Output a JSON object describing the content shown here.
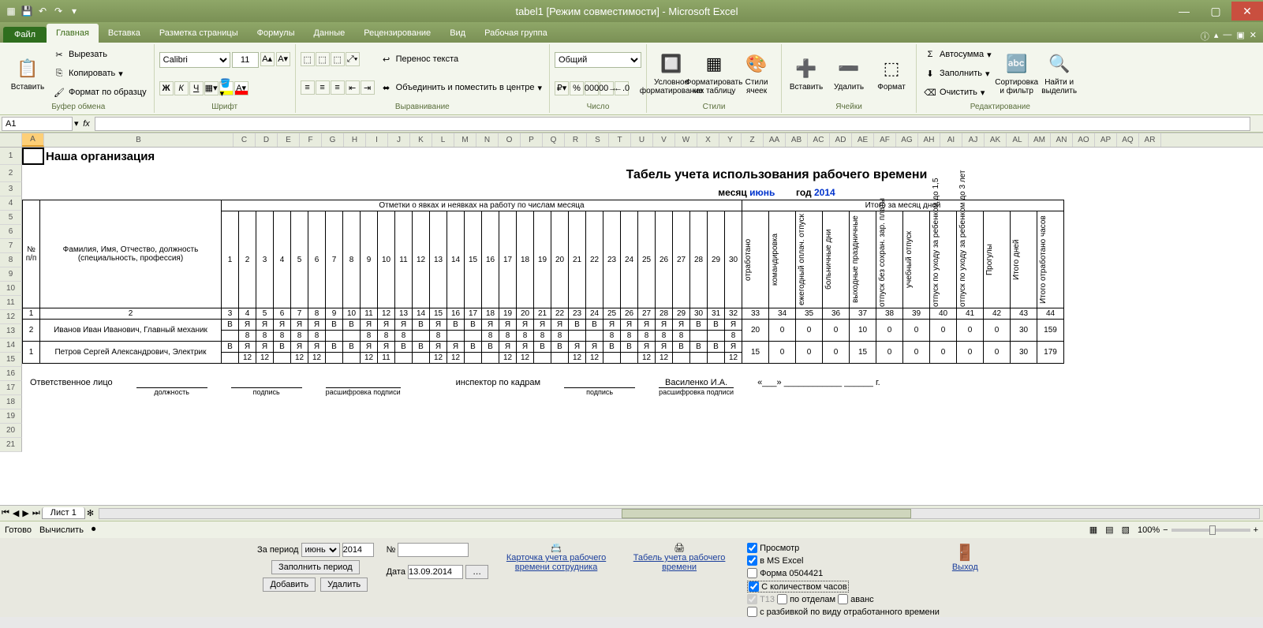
{
  "window": {
    "title": "tabel1  [Режим совместимости] - Microsoft Excel"
  },
  "qat": {
    "save": "💾",
    "undo": "↶",
    "redo": "↷"
  },
  "tabs": {
    "file": "Файл",
    "items": [
      "Главная",
      "Вставка",
      "Разметка страницы",
      "Формулы",
      "Данные",
      "Рецензирование",
      "Вид",
      "Рабочая группа"
    ],
    "active": 0
  },
  "clipboard": {
    "paste": "Вставить",
    "cut": "Вырезать",
    "copy": "Копировать",
    "painter": "Формат по образцу",
    "group": "Буфер обмена"
  },
  "font": {
    "name": "Calibri",
    "size": "11",
    "group": "Шрифт",
    "bold": "Ж",
    "italic": "К",
    "under": "Ч"
  },
  "align": {
    "wrap": "Перенос текста",
    "merge": "Объединить и поместить в центре",
    "group": "Выравнивание"
  },
  "number": {
    "format": "Общий",
    "group": "Число"
  },
  "styles": {
    "cond": "Условное форматирование",
    "table": "Форматировать как таблицу",
    "cellstyles": "Стили ячеек",
    "group": "Стили"
  },
  "cells": {
    "insert": "Вставить",
    "delete": "Удалить",
    "format": "Формат",
    "group": "Ячейки"
  },
  "editing": {
    "sum": "Автосумма",
    "fill": "Заполнить",
    "clear": "Очистить",
    "sort": "Сортировка и фильтр",
    "find": "Найти и выделить",
    "group": "Редактирование"
  },
  "namebox": "A1",
  "columns": [
    "A",
    "B",
    "C",
    "D",
    "E",
    "F",
    "G",
    "H",
    "I",
    "J",
    "K",
    "L",
    "M",
    "N",
    "O",
    "P",
    "Q",
    "R",
    "S",
    "T",
    "U",
    "V",
    "W",
    "X",
    "Y",
    "Z",
    "AA",
    "AB",
    "AC",
    "AD",
    "AE",
    "AF",
    "AG",
    "AH",
    "AI",
    "AJ",
    "AK",
    "AL",
    "AM",
    "AN",
    "AO",
    "AP",
    "AQ",
    "AR"
  ],
  "sheet": {
    "org": "Наша организация",
    "title": "Табель учета использования рабочего времени",
    "month_label": "месяц",
    "month": "июнь",
    "year_label": "год",
    "year": "2014",
    "hdr_marks": "Отметки о явках и неявках на работу по числам месяца",
    "hdr_totals": "Итого за месяц дней",
    "hdr_num": "№ п/п",
    "hdr_fio": "Фамилия, Имя, Отчество, должность (специальность, профессия)",
    "days": [
      "1",
      "2",
      "3",
      "4",
      "5",
      "6",
      "7",
      "8",
      "9",
      "10",
      "11",
      "12",
      "13",
      "14",
      "15",
      "16",
      "17",
      "18",
      "19",
      "20",
      "21",
      "22",
      "23",
      "24",
      "25",
      "26",
      "27",
      "28",
      "29",
      "30"
    ],
    "totcols": [
      "отработано",
      "командировка",
      "ежегодный оплач. отпуск",
      "больничные дни",
      "выходные праздничные",
      "отпуск без сохран. зар. платы",
      "учебный отпуск",
      "отпуск по уходу за ребенком до 1,5",
      "отпуск по уходу за ребенком до 3 лет",
      "Прогулы",
      "Итого дней",
      "Итого отработано часов"
    ],
    "numrow": [
      "1",
      "2",
      "3",
      "4",
      "5",
      "6",
      "7",
      "8",
      "9",
      "10",
      "11",
      "12",
      "13",
      "14",
      "15",
      "16",
      "17",
      "18",
      "19",
      "20",
      "21",
      "22",
      "23",
      "24",
      "25",
      "26",
      "27",
      "28",
      "29",
      "30",
      "31",
      "32",
      "33",
      "34",
      "35",
      "36",
      "37",
      "38",
      "39",
      "40",
      "41",
      "42",
      "43",
      "44"
    ],
    "rows": [
      {
        "n": "2",
        "fio": "Иванов Иван Иванович, Главный механик",
        "marks": [
          "В",
          "Я",
          "Я",
          "Я",
          "Я",
          "Я",
          "В",
          "В",
          "Я",
          "Я",
          "Я",
          "В",
          "Я",
          "В",
          "В",
          "Я",
          "Я",
          "Я",
          "Я",
          "Я",
          "В",
          "В",
          "Я",
          "Я",
          "Я",
          "Я",
          "Я",
          "В",
          "В",
          "Я"
        ],
        "hours": [
          "",
          "8",
          "8",
          "8",
          "8",
          "8",
          "",
          "",
          "8",
          "8",
          "8",
          "",
          "8",
          "",
          "",
          "8",
          "8",
          "8",
          "8",
          "8",
          "",
          "",
          "8",
          "8",
          "8",
          "8",
          "8",
          "",
          "",
          "8"
        ],
        "tot": [
          "20",
          "0",
          "0",
          "0",
          "10",
          "0",
          "0",
          "0",
          "0",
          "0",
          "30",
          "159"
        ]
      },
      {
        "n": "1",
        "fio": "Петров Сергей Александрович, Электрик",
        "marks": [
          "В",
          "Я",
          "Я",
          "В",
          "Я",
          "Я",
          "В",
          "В",
          "Я",
          "Я",
          "В",
          "В",
          "Я",
          "Я",
          "В",
          "В",
          "Я",
          "Я",
          "В",
          "В",
          "Я",
          "Я",
          "В",
          "В",
          "Я",
          "Я",
          "В",
          "В",
          "В",
          "Я"
        ],
        "hours": [
          "",
          "12",
          "12",
          "",
          "12",
          "12",
          "",
          "",
          "12",
          "11",
          "",
          "",
          "12",
          "12",
          "",
          "",
          "12",
          "12",
          "",
          "",
          "12",
          "12",
          "",
          "",
          "12",
          "12",
          "",
          "",
          "",
          "12"
        ],
        "tot": [
          "15",
          "0",
          "0",
          "0",
          "15",
          "0",
          "0",
          "0",
          "0",
          "0",
          "30",
          "179"
        ]
      }
    ],
    "resp": "Ответственное лицо",
    "sig_pos": "должность",
    "sig_sign": "подпись",
    "sig_dec": "расшифровка подписи",
    "insp": "инспектор по кадрам",
    "insp_name": "Василенко И.А.",
    "year_suffix": "г."
  },
  "sheettab": "Лист 1",
  "status": {
    "ready": "Готово",
    "calc": "Вычислить",
    "zoom": "100%"
  },
  "lower": {
    "period": "За период",
    "month": "июнь",
    "year": "2014",
    "fillperiod": "Заполнить период",
    "add": "Добавить",
    "del": "Удалить",
    "num": "№",
    "date": "Дата",
    "dateval": "13.09.2014",
    "card": "Карточка учета рабочего времени сотрудника",
    "tabel": "Табель учета рабочего времени",
    "preview": "Просмотр",
    "excel": "в MS Excel",
    "form": "Форма 0504421",
    "hours": "С количеством часов",
    "t13": "Т13",
    "bydept": "по отделам",
    "avans": "аванс",
    "breakdown": "с разбивкой по виду отработанного времени",
    "exit": "Выход"
  }
}
